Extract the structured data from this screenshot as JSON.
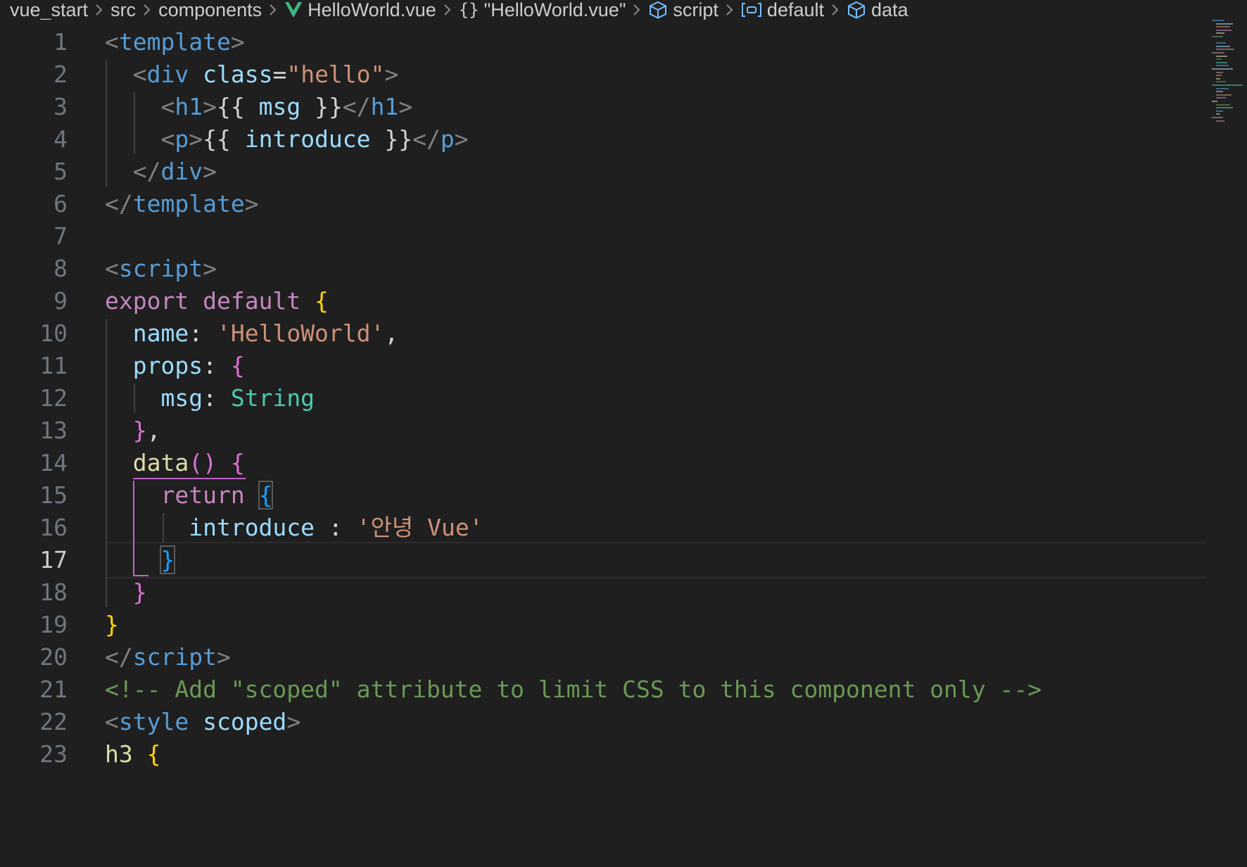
{
  "breadcrumb": [
    {
      "label": "vue_start",
      "icon": ""
    },
    {
      "label": "src",
      "icon": ""
    },
    {
      "label": "components",
      "icon": ""
    },
    {
      "label": "HelloWorld.vue",
      "icon": "vue-logo-icon"
    },
    {
      "label": "\"HelloWorld.vue\"",
      "icon": "braces-icon"
    },
    {
      "label": "script",
      "icon": "cube-icon"
    },
    {
      "label": "default",
      "icon": "variable-icon"
    },
    {
      "label": "data",
      "icon": "cube-icon"
    }
  ],
  "editor": {
    "current_line": 17,
    "lines": [
      {
        "n": "1",
        "tokens": [
          [
            "p",
            "<"
          ],
          [
            "tg",
            "template"
          ],
          [
            "p",
            ">"
          ]
        ]
      },
      {
        "n": "2",
        "tokens": [
          [
            "pl",
            "  "
          ],
          [
            "p",
            "<"
          ],
          [
            "tg",
            "div"
          ],
          [
            "pl",
            " "
          ],
          [
            "at",
            "class"
          ],
          [
            "pl",
            "="
          ],
          [
            "st",
            "\"hello\""
          ],
          [
            "p",
            ">"
          ]
        ]
      },
      {
        "n": "3",
        "tokens": [
          [
            "pl",
            "    "
          ],
          [
            "p",
            "<"
          ],
          [
            "tg",
            "h1"
          ],
          [
            "p",
            ">"
          ],
          [
            "pl",
            "{{ "
          ],
          [
            "at",
            "msg"
          ],
          [
            "pl",
            " }}"
          ],
          [
            "p",
            "</"
          ],
          [
            "tg",
            "h1"
          ],
          [
            "p",
            ">"
          ]
        ]
      },
      {
        "n": "4",
        "tokens": [
          [
            "pl",
            "    "
          ],
          [
            "p",
            "<"
          ],
          [
            "tg",
            "p"
          ],
          [
            "p",
            ">"
          ],
          [
            "pl",
            "{{ "
          ],
          [
            "at",
            "introduce"
          ],
          [
            "pl",
            " }}"
          ],
          [
            "p",
            "</"
          ],
          [
            "tg",
            "p"
          ],
          [
            "p",
            ">"
          ]
        ]
      },
      {
        "n": "5",
        "tokens": [
          [
            "pl",
            "  "
          ],
          [
            "p",
            "</"
          ],
          [
            "tg",
            "div"
          ],
          [
            "p",
            ">"
          ]
        ]
      },
      {
        "n": "6",
        "tokens": [
          [
            "p",
            "</"
          ],
          [
            "tg",
            "template"
          ],
          [
            "p",
            ">"
          ]
        ]
      },
      {
        "n": "7",
        "tokens": []
      },
      {
        "n": "8",
        "tokens": [
          [
            "p",
            "<"
          ],
          [
            "tg",
            "script"
          ],
          [
            "p",
            ">"
          ]
        ]
      },
      {
        "n": "9",
        "tokens": [
          [
            "kw",
            "export"
          ],
          [
            "pl",
            " "
          ],
          [
            "kw",
            "default"
          ],
          [
            "pl",
            " "
          ],
          [
            "b1",
            "{"
          ]
        ]
      },
      {
        "n": "10",
        "tokens": [
          [
            "pl",
            "  "
          ],
          [
            "at",
            "name"
          ],
          [
            "pl",
            ": "
          ],
          [
            "st",
            "'HelloWorld'"
          ],
          [
            "pl",
            ","
          ]
        ]
      },
      {
        "n": "11",
        "tokens": [
          [
            "pl",
            "  "
          ],
          [
            "at",
            "props"
          ],
          [
            "pl",
            ": "
          ],
          [
            "b2",
            "{"
          ]
        ]
      },
      {
        "n": "12",
        "tokens": [
          [
            "pl",
            "    "
          ],
          [
            "at",
            "msg"
          ],
          [
            "pl",
            ": "
          ],
          [
            "cp",
            "String"
          ]
        ]
      },
      {
        "n": "13",
        "tokens": [
          [
            "pl",
            "  "
          ],
          [
            "b2",
            "}"
          ],
          [
            "pl",
            ","
          ]
        ]
      },
      {
        "n": "14",
        "tokens": [
          [
            "pl",
            "  "
          ],
          [
            "fn",
            "data"
          ],
          [
            "b2",
            "()"
          ],
          [
            "pl",
            " "
          ],
          [
            "b2",
            "{"
          ]
        ]
      },
      {
        "n": "15",
        "tokens": [
          [
            "pl",
            "    "
          ],
          [
            "kw",
            "return"
          ],
          [
            "pl",
            " "
          ],
          [
            "b3",
            "{"
          ]
        ]
      },
      {
        "n": "16",
        "tokens": [
          [
            "pl",
            "      "
          ],
          [
            "at",
            "introduce"
          ],
          [
            "pl",
            " : "
          ],
          [
            "st",
            "'안녕 Vue'"
          ]
        ]
      },
      {
        "n": "17",
        "tokens": [
          [
            "pl",
            "    "
          ],
          [
            "b3",
            "}"
          ]
        ]
      },
      {
        "n": "18",
        "tokens": [
          [
            "pl",
            "  "
          ],
          [
            "b2",
            "}"
          ]
        ]
      },
      {
        "n": "19",
        "tokens": [
          [
            "b1",
            "}"
          ]
        ]
      },
      {
        "n": "20",
        "tokens": [
          [
            "p",
            "</"
          ],
          [
            "tg",
            "script"
          ],
          [
            "p",
            ">"
          ]
        ]
      },
      {
        "n": "21",
        "tokens": [
          [
            "cm",
            "<!-- Add \"scoped\" attribute to limit CSS to this component only -->"
          ]
        ]
      },
      {
        "n": "22",
        "tokens": [
          [
            "p",
            "<"
          ],
          [
            "tg",
            "style"
          ],
          [
            "pl",
            " "
          ],
          [
            "at",
            "scoped"
          ],
          [
            "p",
            ">"
          ]
        ]
      },
      {
        "n": "23",
        "tokens": [
          [
            "fn",
            "h3"
          ],
          [
            "pl",
            " "
          ],
          [
            "b1",
            "{"
          ]
        ]
      }
    ]
  },
  "colors": {
    "background": "#1f1f1f",
    "tag": "#569cd6",
    "attribute": "#9cdcfe",
    "string": "#ce9178",
    "keyword": "#c586c0",
    "type": "#4ec9b0",
    "function": "#dcdcaa",
    "comment": "#6a9955",
    "bracket_level1": "#ffd700",
    "bracket_level2": "#da70d6",
    "bracket_level3": "#179fff",
    "vue_logo": "#41b883",
    "symbol_icon": "#75beff"
  }
}
